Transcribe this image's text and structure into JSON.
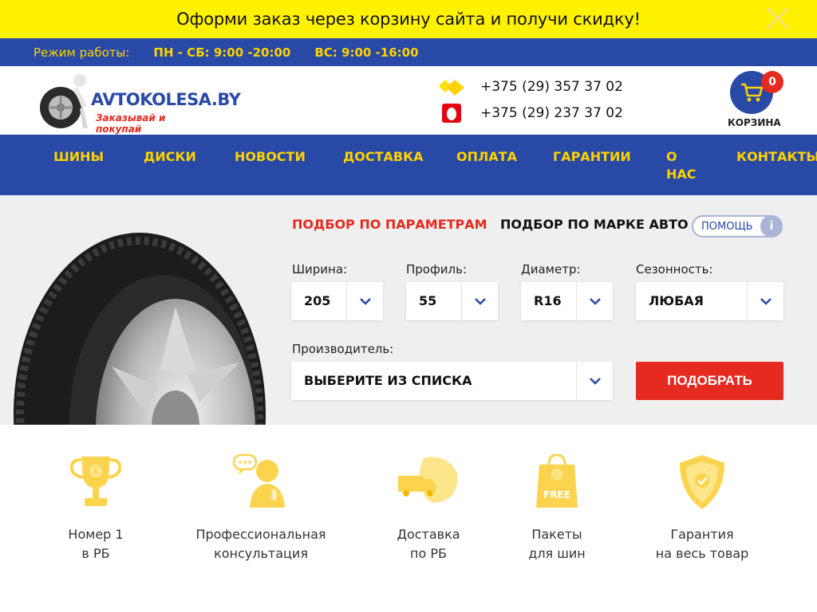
{
  "promo": {
    "text": "Оформи заказ через корзину сайта и получи скидку!",
    "close_icon": "close-icon"
  },
  "hours": {
    "label": "Режим работы:",
    "weekdays": "ПН - СБ: 9:00 -20:00",
    "sunday": "ВС: 9:00 -16:00"
  },
  "header": {
    "logo_name": "AVTOKOLESA.BY",
    "logo_tagline": "Заказывай и покупай",
    "phones": [
      {
        "number": "+375 (29) 357 37 02",
        "icon": "velcom-icon"
      },
      {
        "number": "+375 (29) 237 37 02",
        "icon": "mts-icon"
      }
    ],
    "cart": {
      "count": "0",
      "label": "КОРЗИНА",
      "icon": "cart-icon"
    }
  },
  "nav": {
    "items": [
      {
        "label": "ШИНЫ"
      },
      {
        "label": "ДИСКИ"
      },
      {
        "label": "НОВОСТИ"
      },
      {
        "label": "ДОСТАВКА"
      },
      {
        "label": "ОПЛАТА"
      },
      {
        "label": "ГАРАНТИИ"
      },
      {
        "label": "О НАС"
      },
      {
        "label": "КОНТАКТЫ"
      }
    ]
  },
  "search": {
    "tab_params": "ПОДБОР ПО ПАРАМЕТРАМ",
    "tab_brand": "ПОДБОР ПО МАРКЕ АВТО",
    "help_label": "ПОМОЩЬ",
    "help_icon_glyph": "i",
    "width": {
      "label": "Ширина:",
      "value": "205"
    },
    "profile": {
      "label": "Профиль:",
      "value": "55"
    },
    "diameter": {
      "label": "Диаметр:",
      "value": "R16"
    },
    "season": {
      "label": "Сезонность:",
      "value": "ЛЮБАЯ"
    },
    "manufacturer": {
      "label": "Производитель:",
      "value": "ВЫБЕРИТЕ ИЗ СПИСКА"
    },
    "submit_label": "ПОДОБРАТЬ"
  },
  "features": [
    {
      "line1": "Номер 1",
      "line2": "в РБ",
      "icon": "trophy-icon"
    },
    {
      "line1": "Профессиональная",
      "line2": "консультация",
      "icon": "consultant-icon"
    },
    {
      "line1": "Доставка",
      "line2": "по РБ",
      "icon": "delivery-truck-icon"
    },
    {
      "line1": "Пакеты",
      "line2": "для шин",
      "icon": "free-bag-icon",
      "badge": "FREE",
      "badge_digit": "1"
    },
    {
      "line1": "Гарантия",
      "line2": "на весь товар",
      "icon": "shield-check-icon"
    }
  ],
  "colors": {
    "brand_blue": "#2849a5",
    "accent_yellow": "#ffd200",
    "promo_yellow": "#fff200",
    "accent_red": "#e52a1f",
    "icon_yellow": "#fcd34d"
  }
}
